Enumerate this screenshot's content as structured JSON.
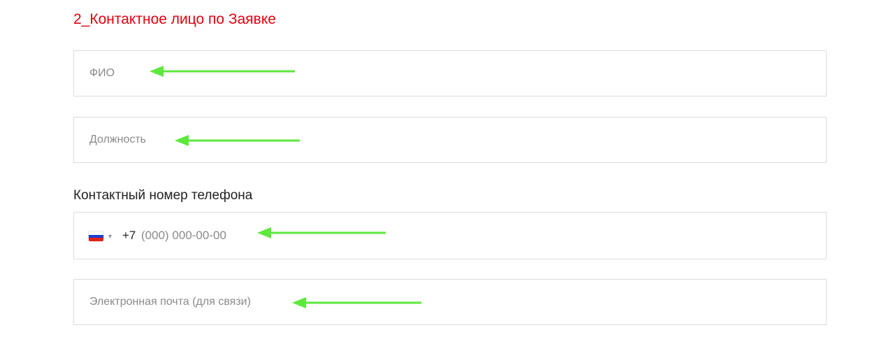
{
  "section": {
    "title": "2_Контактное лицо по Заявке"
  },
  "fields": {
    "fio": {
      "placeholder": "ФИО",
      "value": ""
    },
    "position": {
      "placeholder": "Должность",
      "value": ""
    },
    "phone": {
      "label": "Контактный номер телефона",
      "country_flag": "russia-flag-icon",
      "country_code": "+7",
      "placeholder": "(000) 000-00-00",
      "value": ""
    },
    "email": {
      "placeholder": "Электронная почта (для связи)",
      "value": ""
    }
  },
  "colors": {
    "title": "#e3000f",
    "annotation_arrow": "#5ee83d",
    "field_border": "#dcdcdc",
    "placeholder": "#8a8a8a"
  },
  "icons": {
    "arrow": "left-arrow-icon",
    "caret": "chevron-down-icon"
  }
}
